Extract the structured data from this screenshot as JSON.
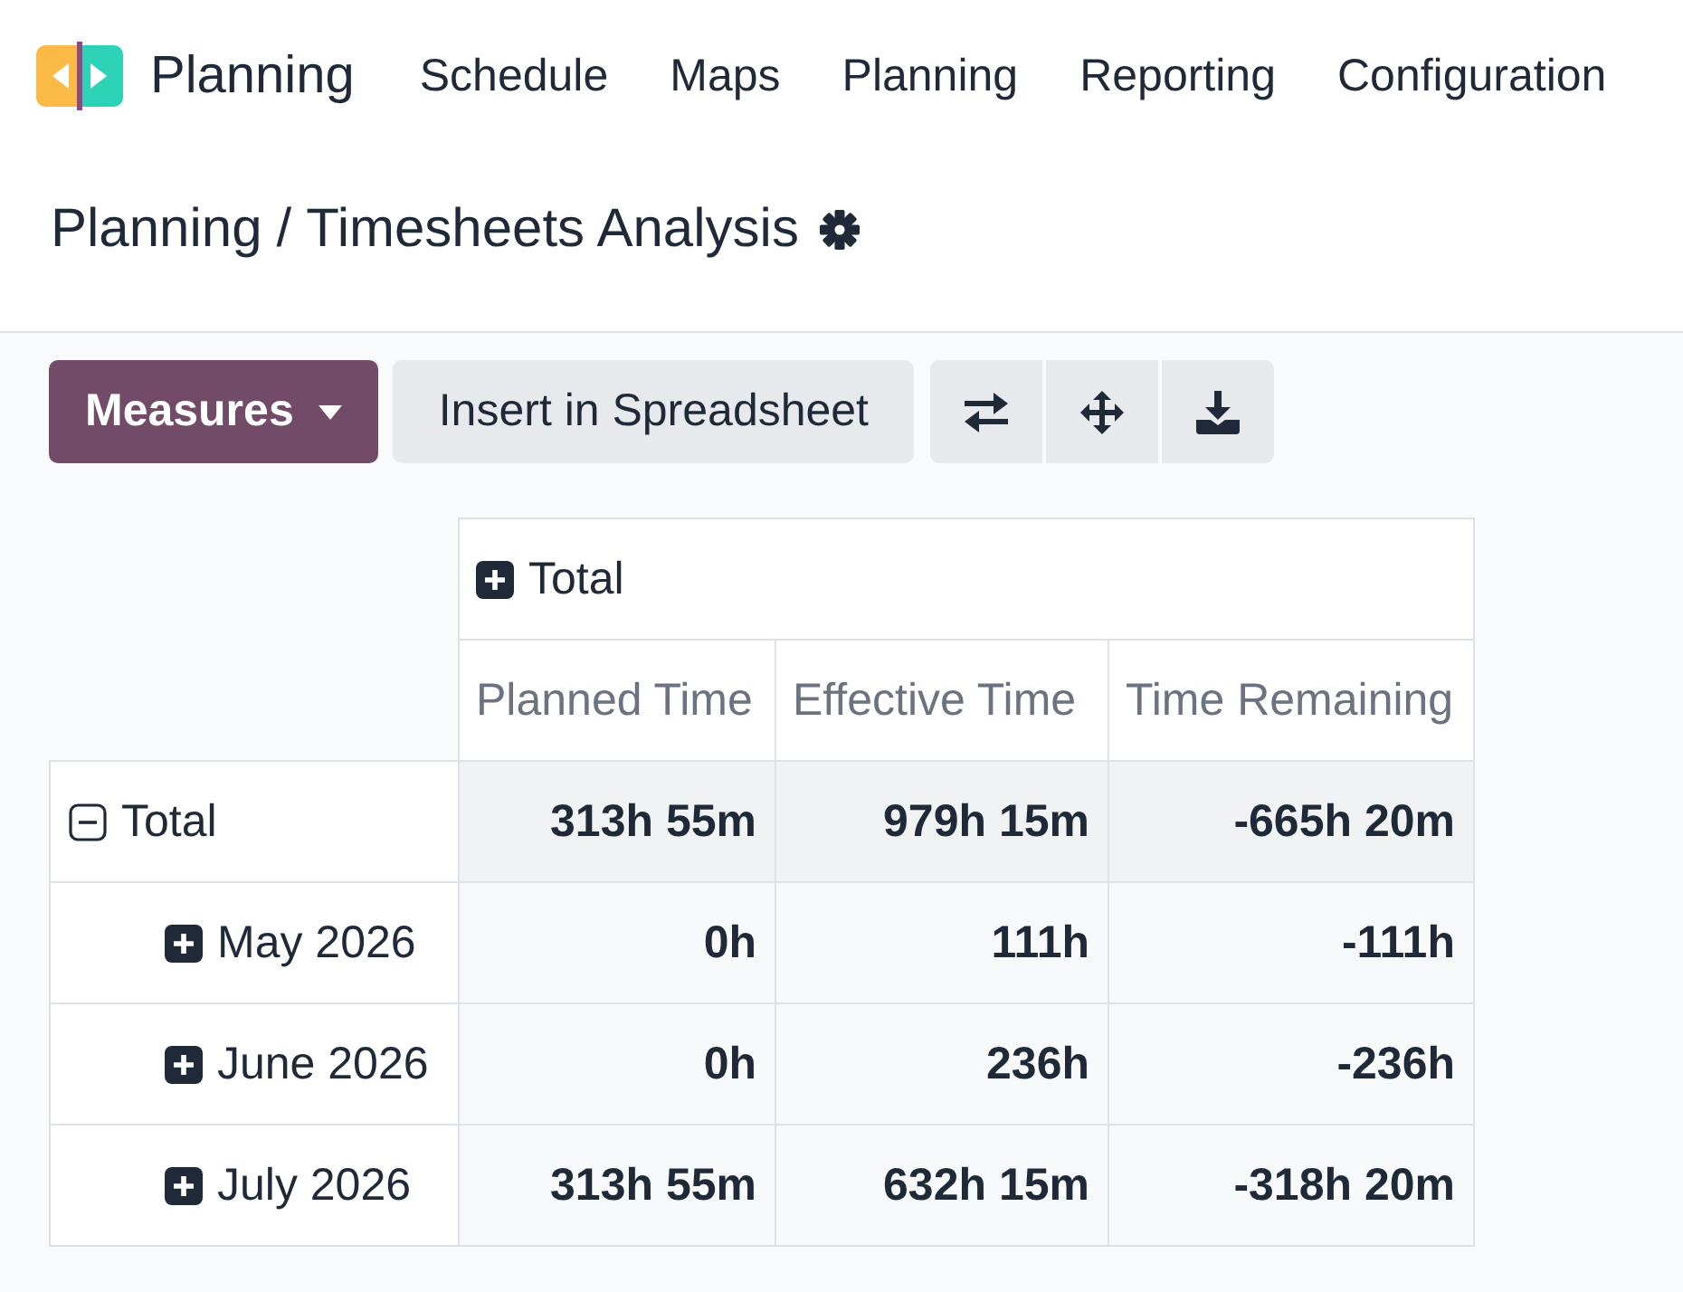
{
  "navbar": {
    "app_name": "Planning",
    "menu": [
      {
        "label": "Schedule"
      },
      {
        "label": "Maps"
      },
      {
        "label": "Planning"
      },
      {
        "label": "Reporting"
      },
      {
        "label": "Configuration"
      }
    ]
  },
  "breadcrumb": {
    "parent": "Planning",
    "separator": "/",
    "current": "Timesheets Analysis"
  },
  "toolbar": {
    "measures_button": "Measures",
    "insert_button": "Insert in Spreadsheet"
  },
  "pivot": {
    "column_header": {
      "label": "Total",
      "expanded": false
    },
    "measures": [
      "Planned Time",
      "Effective Time",
      "Time Remaining"
    ],
    "rows": [
      {
        "label": "Total",
        "expanded": true,
        "values": [
          "313h 55m",
          "979h 15m",
          "-665h 20m"
        ],
        "children": [
          {
            "label": "May 2026",
            "expanded": false,
            "values": [
              "0h",
              "111h",
              "-111h"
            ]
          },
          {
            "label": "June 2026",
            "expanded": false,
            "values": [
              "0h",
              "236h",
              "-236h"
            ]
          },
          {
            "label": "July 2026",
            "expanded": false,
            "values": [
              "313h 55m",
              "632h 15m",
              "-318h 20m"
            ]
          }
        ]
      }
    ]
  }
}
